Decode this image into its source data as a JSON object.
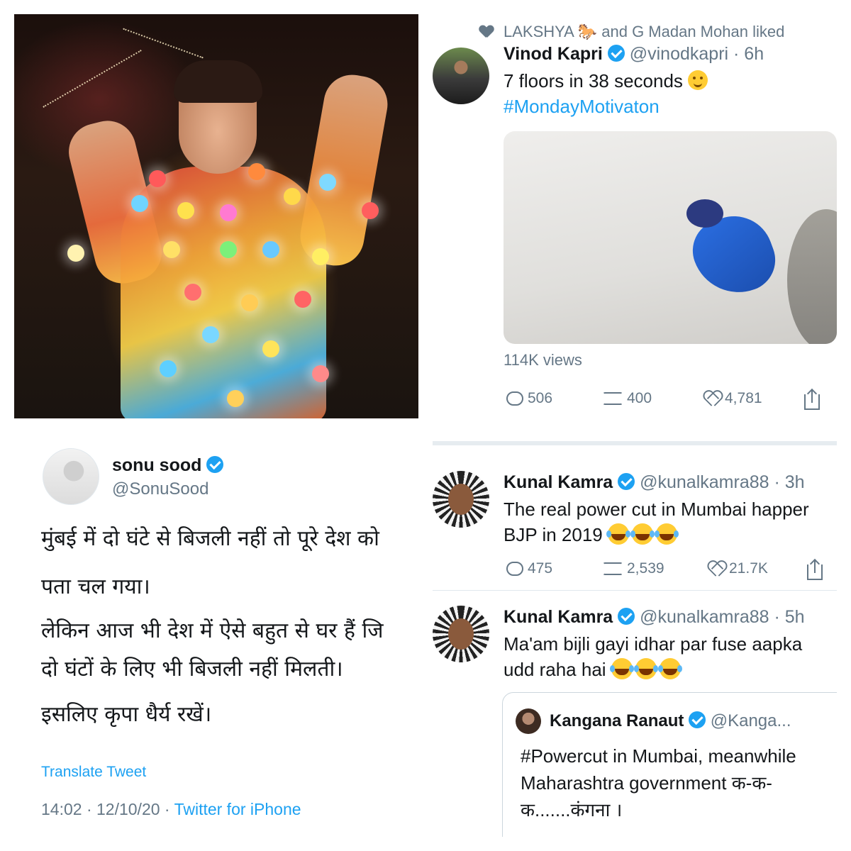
{
  "tweet_video": {
    "liked_by": "LAKSHYA 🐎 and G Madan Mohan liked",
    "author_name": "Vinod Kapri",
    "author_handle": "@vinodkapri · 6h",
    "text": "7 floors in 38 seconds",
    "hashtag": "#MondayMotivaton",
    "views": "114K views",
    "replies": "506",
    "retweets": "400",
    "likes": "4,781"
  },
  "tweet_sonu": {
    "author_name": "sonu sood",
    "author_handle": "@SonuSood",
    "lines": [
      "मुंबई में दो घंटे से बिजली नहीं तो पूरे देश को",
      "पता चल गया।",
      "लेकिन आज भी देश में ऐसे बहुत से घर हैं जि",
      "दो घंटों के लिए भी बिजली नहीं मिलती।",
      "इसलिए कृपा धैर्य रखें।"
    ],
    "translate": "Translate Tweet",
    "timestamp": "14:02 · 12/10/20 · ",
    "source": "Twitter for iPhone"
  },
  "tweet_kunal_1": {
    "author_name": "Kunal Kamra",
    "author_handle": "@kunalkamra88 · 3h",
    "line1": "The real power cut in Mumbai happer",
    "line2": "BJP in 2019",
    "replies": "475",
    "retweets": "2,539",
    "likes": "21.7K"
  },
  "tweet_kunal_2": {
    "author_name": "Kunal Kamra",
    "author_handle": "@kunalkamra88 · 5h",
    "line1": "Ma'am bijli gayi idhar par fuse aapka",
    "line2": "udd raha hai"
  },
  "quoted_tweet": {
    "author_name": "Kangana Ranaut",
    "author_handle": "@Kanga...",
    "line1": "#Powercut in Mumbai, meanwhile",
    "line2": "Maharashtra government क-क-",
    "line3": "क.......कंगना ।"
  },
  "colors": {
    "link_blue": "#1da1f2",
    "muted_gray": "#657786",
    "text_dark": "#14171a"
  },
  "icons": [
    "heart-icon",
    "verified-badge-icon",
    "reply-icon",
    "retweet-icon",
    "like-icon",
    "share-icon",
    "smile-emoji",
    "laughing-emoji"
  ]
}
